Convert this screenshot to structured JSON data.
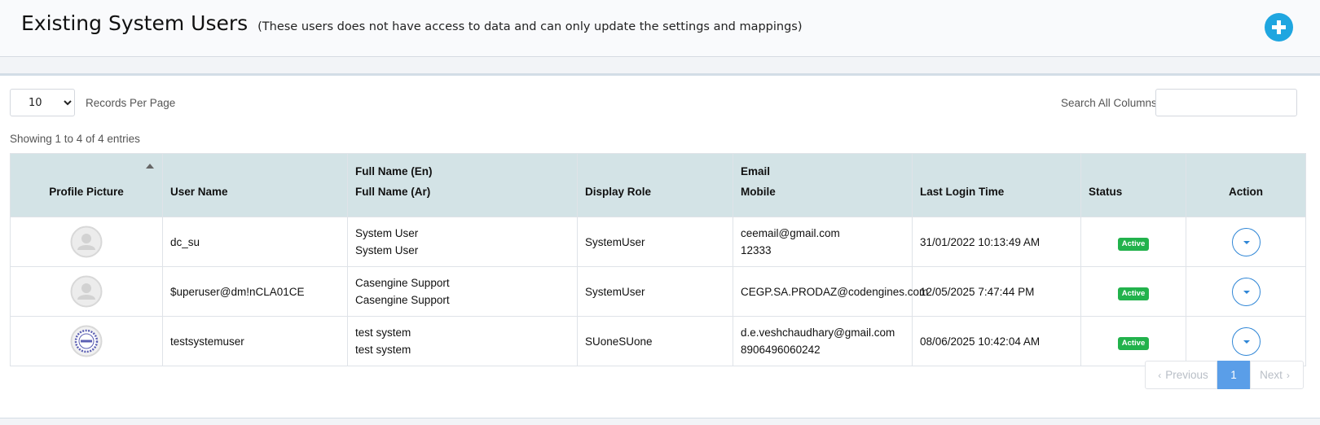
{
  "header": {
    "title": "Existing System Users",
    "subtitle": "(These users does not have access to data and can only update the settings and mappings)",
    "add_icon": "plus-circle-icon",
    "accent_color": "#1fa6e0"
  },
  "controls": {
    "page_length": "10",
    "page_length_label": "Records Per Page",
    "search_label": "Search All Columns",
    "search_value": ""
  },
  "info": "Showing 1 to 4 of 4 entries",
  "table": {
    "header": {
      "profile_picture": "Profile Picture",
      "user_name": "User Name",
      "full_name_en": "Full Name (En)",
      "full_name_ar": "Full Name (Ar)",
      "display_role": "Display Role",
      "email": "Email",
      "mobile": "Mobile",
      "last_login": "Last Login Time",
      "status": "Status",
      "action": "Action"
    },
    "rows": [
      {
        "avatar": "default-user-avatar",
        "user_name": "dc_su",
        "full_name_en": "System User",
        "full_name_ar": "System User",
        "display_role": "SystemUser",
        "email": "ceemail@gmail.com",
        "mobile": "12333",
        "last_login": "31/01/2022 10:13:49 AM",
        "status": "Active"
      },
      {
        "avatar": "default-user-avatar",
        "user_name": "$uperuser@dm!nCLA01CE",
        "full_name_en": "Casengine Support",
        "full_name_ar": "Casengine Support",
        "display_role": "SystemUser",
        "email": "CEGP.SA.PRODAZ@codengines.com",
        "mobile": "",
        "last_login": "12/05/2025 7:47:44 PM",
        "status": "Active"
      },
      {
        "avatar": "seal-avatar",
        "user_name": "testsystemuser",
        "full_name_en": "test system",
        "full_name_ar": "test system",
        "display_role": "SUoneSUone",
        "email": "d.e.veshchaudhary@gmail.com",
        "mobile": "8906496060242",
        "last_login": "08/06/2025 10:42:04 AM",
        "status": "Active"
      }
    ]
  },
  "pagination": {
    "previous_label": "Previous",
    "current_page": "1",
    "next_label": "Next"
  },
  "colors": {
    "header_row": "#d3e3e6",
    "status_active": "#22b24c",
    "page_active": "#5a9ee8"
  }
}
